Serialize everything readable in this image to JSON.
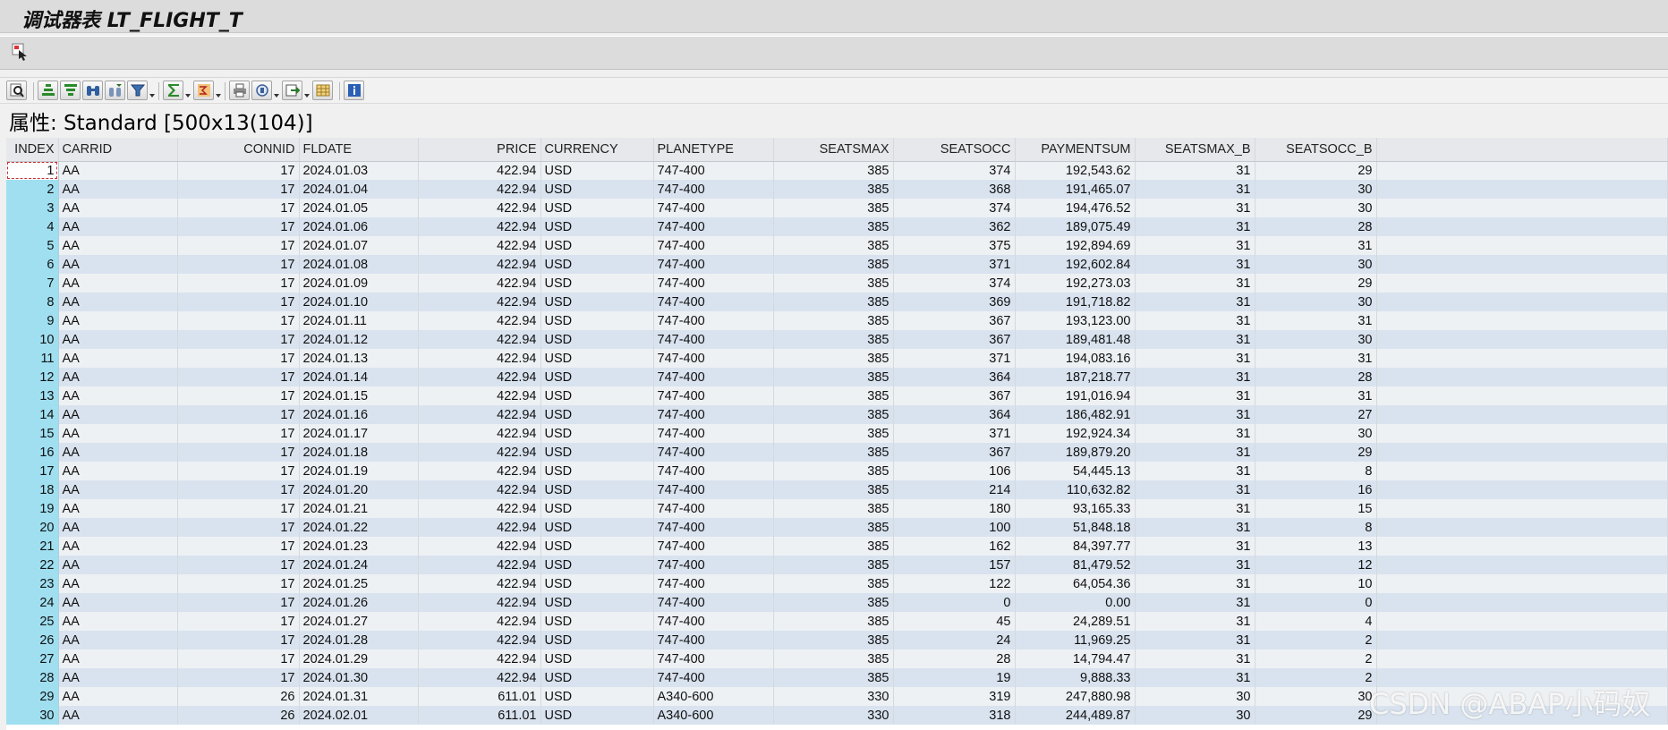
{
  "window": {
    "title": "调试器表 LT_FLIGHT_T"
  },
  "toolbar": {
    "icons": [
      "find-icon",
      "sort-ascending-icon",
      "sort-descending-icon",
      "find-binoculars-icon",
      "find-next-icon",
      "filter-icon",
      "sum-icon",
      "subtotal-icon",
      "print-icon",
      "layout-icon",
      "export-icon",
      "grid-layout-icon",
      "info-icon"
    ]
  },
  "header": {
    "property_label": "属性: Standard [500x13(104)]"
  },
  "table": {
    "columns": [
      "INDEX",
      "CARRID",
      "CONNID",
      "FLDATE",
      "PRICE",
      "CURRENCY",
      "PLANETYPE",
      "SEATSMAX",
      "SEATSOCC",
      "PAYMENTSUM",
      "SEATSMAX_B",
      "SEATSOCC_B"
    ],
    "rows": [
      [
        "1",
        "AA",
        "17",
        "2024.01.03",
        "422.94",
        "USD",
        "747-400",
        "385",
        "374",
        "192,543.62",
        "31",
        "29"
      ],
      [
        "2",
        "AA",
        "17",
        "2024.01.04",
        "422.94",
        "USD",
        "747-400",
        "385",
        "368",
        "191,465.07",
        "31",
        "30"
      ],
      [
        "3",
        "AA",
        "17",
        "2024.01.05",
        "422.94",
        "USD",
        "747-400",
        "385",
        "374",
        "194,476.52",
        "31",
        "30"
      ],
      [
        "4",
        "AA",
        "17",
        "2024.01.06",
        "422.94",
        "USD",
        "747-400",
        "385",
        "362",
        "189,075.49",
        "31",
        "28"
      ],
      [
        "5",
        "AA",
        "17",
        "2024.01.07",
        "422.94",
        "USD",
        "747-400",
        "385",
        "375",
        "192,894.69",
        "31",
        "31"
      ],
      [
        "6",
        "AA",
        "17",
        "2024.01.08",
        "422.94",
        "USD",
        "747-400",
        "385",
        "371",
        "192,602.84",
        "31",
        "30"
      ],
      [
        "7",
        "AA",
        "17",
        "2024.01.09",
        "422.94",
        "USD",
        "747-400",
        "385",
        "374",
        "192,273.03",
        "31",
        "29"
      ],
      [
        "8",
        "AA",
        "17",
        "2024.01.10",
        "422.94",
        "USD",
        "747-400",
        "385",
        "369",
        "191,718.82",
        "31",
        "30"
      ],
      [
        "9",
        "AA",
        "17",
        "2024.01.11",
        "422.94",
        "USD",
        "747-400",
        "385",
        "367",
        "193,123.00",
        "31",
        "31"
      ],
      [
        "10",
        "AA",
        "17",
        "2024.01.12",
        "422.94",
        "USD",
        "747-400",
        "385",
        "367",
        "189,481.48",
        "31",
        "30"
      ],
      [
        "11",
        "AA",
        "17",
        "2024.01.13",
        "422.94",
        "USD",
        "747-400",
        "385",
        "371",
        "194,083.16",
        "31",
        "31"
      ],
      [
        "12",
        "AA",
        "17",
        "2024.01.14",
        "422.94",
        "USD",
        "747-400",
        "385",
        "364",
        "187,218.77",
        "31",
        "28"
      ],
      [
        "13",
        "AA",
        "17",
        "2024.01.15",
        "422.94",
        "USD",
        "747-400",
        "385",
        "367",
        "191,016.94",
        "31",
        "31"
      ],
      [
        "14",
        "AA",
        "17",
        "2024.01.16",
        "422.94",
        "USD",
        "747-400",
        "385",
        "364",
        "186,482.91",
        "31",
        "27"
      ],
      [
        "15",
        "AA",
        "17",
        "2024.01.17",
        "422.94",
        "USD",
        "747-400",
        "385",
        "371",
        "192,924.34",
        "31",
        "30"
      ],
      [
        "16",
        "AA",
        "17",
        "2024.01.18",
        "422.94",
        "USD",
        "747-400",
        "385",
        "367",
        "189,879.20",
        "31",
        "29"
      ],
      [
        "17",
        "AA",
        "17",
        "2024.01.19",
        "422.94",
        "USD",
        "747-400",
        "385",
        "106",
        "54,445.13",
        "31",
        "8"
      ],
      [
        "18",
        "AA",
        "17",
        "2024.01.20",
        "422.94",
        "USD",
        "747-400",
        "385",
        "214",
        "110,632.82",
        "31",
        "16"
      ],
      [
        "19",
        "AA",
        "17",
        "2024.01.21",
        "422.94",
        "USD",
        "747-400",
        "385",
        "180",
        "93,165.33",
        "31",
        "15"
      ],
      [
        "20",
        "AA",
        "17",
        "2024.01.22",
        "422.94",
        "USD",
        "747-400",
        "385",
        "100",
        "51,848.18",
        "31",
        "8"
      ],
      [
        "21",
        "AA",
        "17",
        "2024.01.23",
        "422.94",
        "USD",
        "747-400",
        "385",
        "162",
        "84,397.77",
        "31",
        "13"
      ],
      [
        "22",
        "AA",
        "17",
        "2024.01.24",
        "422.94",
        "USD",
        "747-400",
        "385",
        "157",
        "81,479.52",
        "31",
        "12"
      ],
      [
        "23",
        "AA",
        "17",
        "2024.01.25",
        "422.94",
        "USD",
        "747-400",
        "385",
        "122",
        "64,054.36",
        "31",
        "10"
      ],
      [
        "24",
        "AA",
        "17",
        "2024.01.26",
        "422.94",
        "USD",
        "747-400",
        "385",
        "0",
        "0.00",
        "31",
        "0"
      ],
      [
        "25",
        "AA",
        "17",
        "2024.01.27",
        "422.94",
        "USD",
        "747-400",
        "385",
        "45",
        "24,289.51",
        "31",
        "4"
      ],
      [
        "26",
        "AA",
        "17",
        "2024.01.28",
        "422.94",
        "USD",
        "747-400",
        "385",
        "24",
        "11,969.25",
        "31",
        "2"
      ],
      [
        "27",
        "AA",
        "17",
        "2024.01.29",
        "422.94",
        "USD",
        "747-400",
        "385",
        "28",
        "14,794.47",
        "31",
        "2"
      ],
      [
        "28",
        "AA",
        "17",
        "2024.01.30",
        "422.94",
        "USD",
        "747-400",
        "385",
        "19",
        "9,888.33",
        "31",
        "2"
      ],
      [
        "29",
        "AA",
        "26",
        "2024.01.31",
        "611.01",
        "USD",
        "A340-600",
        "330",
        "319",
        "247,880.98",
        "30",
        "30"
      ],
      [
        "30",
        "AA",
        "26",
        "2024.02.01",
        "611.01",
        "USD",
        "A340-600",
        "330",
        "318",
        "244,489.87",
        "30",
        "29"
      ]
    ]
  },
  "watermark": "CSDN @ABAP小码奴"
}
